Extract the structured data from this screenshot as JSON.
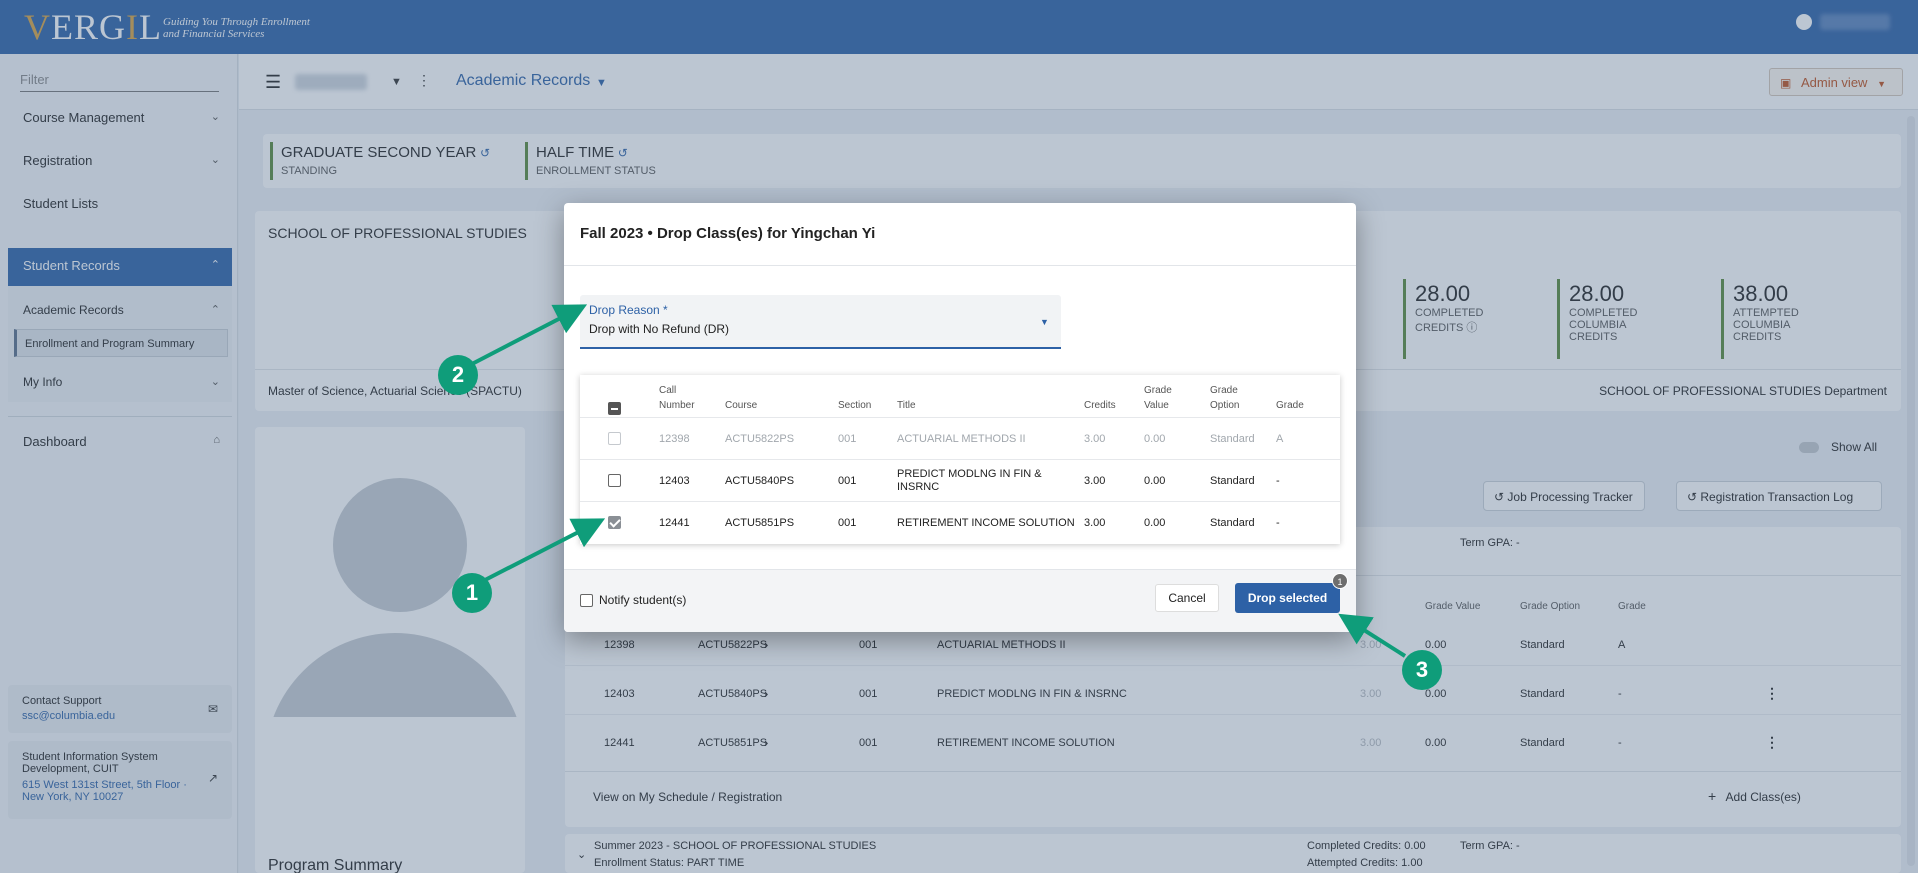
{
  "header": {
    "logo_text": "VERGIL",
    "tagline_1": "Guiding You Through Enrollment",
    "tagline_2": "and Financial Services"
  },
  "sidebar": {
    "filter_placeholder": "Filter",
    "items": [
      {
        "label": "Course Management"
      },
      {
        "label": "Registration"
      },
      {
        "label": "Student Lists"
      },
      {
        "label": "Student Records"
      },
      {
        "label": "Academic Records"
      },
      {
        "label": "Enrollment and Program Summary"
      },
      {
        "label": "My Info"
      },
      {
        "label": "Dashboard"
      }
    ],
    "support": {
      "title": "Contact Support",
      "email": "ssc@columbia.edu"
    },
    "org": {
      "title_1": "Student Information System",
      "title_2": "Development, CUIT",
      "addr_1": "615 West 131st Street, 5th Floor ·",
      "addr_2": "New York, NY 10027"
    }
  },
  "toolbar": {
    "page_title": "Academic Records",
    "admin_view": "Admin view"
  },
  "standing": {
    "value": "GRADUATE SECOND YEAR",
    "label": "STANDING"
  },
  "enrollment_status": {
    "value": "HALF TIME",
    "label": "ENROLLMENT STATUS"
  },
  "school": "SCHOOL OF PROFESSIONAL STUDIES",
  "program": "Master of Science, Actuarial Science (SPACTU)",
  "department": "SCHOOL OF PROFESSIONAL STUDIES Department",
  "credits": [
    {
      "value": "28.00",
      "line1": "COMPLETED",
      "line2": "CREDITS"
    },
    {
      "value": "28.00",
      "line1": "COMPLETED",
      "line2": "COLUMBIA",
      "line3": "CREDITS"
    },
    {
      "value": "38.00",
      "line1": "ATTEMPTED",
      "line2": "COLUMBIA",
      "line3": "CREDITS"
    }
  ],
  "show_all": "Show All",
  "job_tracker": "Job Processing Tracker",
  "reg_log": "Registration Transaction Log",
  "term_gpa": "Term GPA: -",
  "bg_table": {
    "headers": [
      "Grade Value",
      "Grade Option",
      "Grade"
    ],
    "rows": [
      {
        "call": "12398",
        "course": "ACTU5822PS",
        "section": "001",
        "title": "ACTUARIAL METHODS II",
        "credits": "3.00",
        "grade_value": "0.00",
        "option": "Standard",
        "grade": "A"
      },
      {
        "call": "12403",
        "course": "ACTU5840PS",
        "section": "001",
        "title": "PREDICT MODLNG IN FIN & INSRNC",
        "credits": "3.00",
        "grade_value": "0.00",
        "option": "Standard",
        "grade": "-"
      },
      {
        "call": "12441",
        "course": "ACTU5851PS",
        "section": "001",
        "title": "RETIREMENT INCOME SOLUTION",
        "credits": "3.00",
        "grade_value": "0.00",
        "option": "Standard",
        "grade": "-"
      }
    ]
  },
  "schedule_link": "View on My Schedule / Registration",
  "add_classes": "Add Class(es)",
  "program_summary": "Program Summary",
  "summer": {
    "title": "Summer 2023 - SCHOOL OF PROFESSIONAL STUDIES",
    "status": "Enrollment Status: PART TIME",
    "completed": "Completed Credits: 0.00",
    "attempted": "Attempted Credits: 1.00",
    "gpa": "Term GPA: -"
  },
  "modal": {
    "title": "Fall 2023 • Drop Class(es) for Yingchan Yi",
    "drop_reason_label": "Drop Reason *",
    "drop_reason_value": "Drop with No Refund (DR)",
    "columns": {
      "call_1": "Call",
      "call_2": "Number",
      "course": "Course",
      "section": "Section",
      "title": "Title",
      "credits": "Credits",
      "gv_1": "Grade",
      "gv_2": "Value",
      "go_1": "Grade",
      "go_2": "Option",
      "grade": "Grade"
    },
    "rows": [
      {
        "call": "12398",
        "course": "ACTU5822PS",
        "section": "001",
        "title": "ACTUARIAL METHODS II",
        "credits": "3.00",
        "grade_value": "0.00",
        "option": "Standard",
        "grade": "A",
        "state": "disabled"
      },
      {
        "call": "12403",
        "course": "ACTU5840PS",
        "section": "001",
        "title_1": "PREDICT MODLNG IN FIN &",
        "title_2": "INSRNC",
        "credits": "3.00",
        "grade_value": "0.00",
        "option": "Standard",
        "grade": "-",
        "state": "unchecked"
      },
      {
        "call": "12441",
        "course": "ACTU5851PS",
        "section": "001",
        "title": "RETIREMENT INCOME SOLUTION",
        "credits": "3.00",
        "grade_value": "0.00",
        "option": "Standard",
        "grade": "-",
        "state": "checked"
      }
    ],
    "notify_label": "Notify student(s)",
    "cancel_label": "Cancel",
    "drop_label": "Drop selected",
    "selected_count": "1"
  },
  "annotations": [
    "1",
    "2",
    "3"
  ],
  "colors": {
    "brand_blue": "#2d61a6",
    "annotation_teal": "#0f9d7a",
    "status_green": "#5a8a3a",
    "admin_orange": "#c0501c"
  }
}
